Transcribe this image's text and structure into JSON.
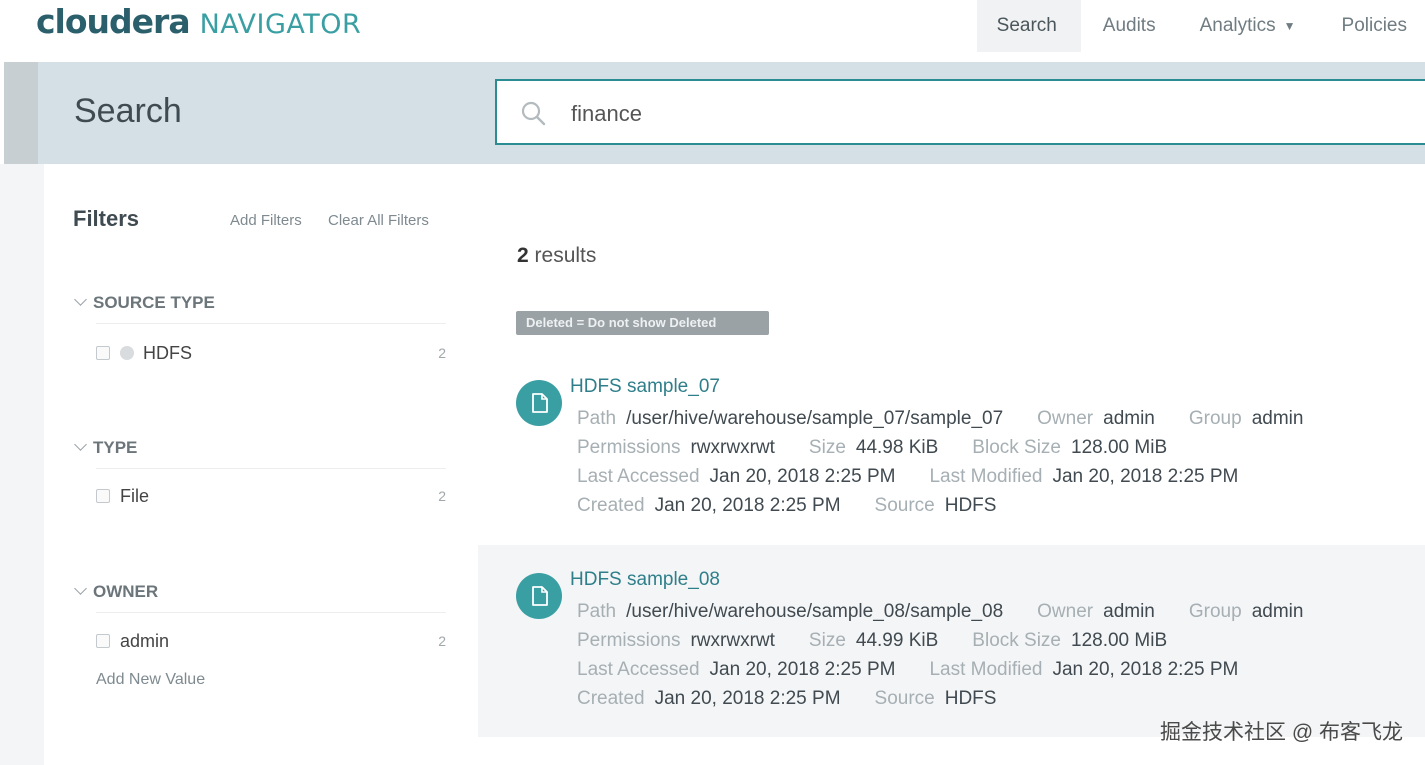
{
  "header": {
    "logo_brand": "cloudera",
    "logo_product": "NAVIGATOR",
    "nav": [
      {
        "label": "Search",
        "active": true
      },
      {
        "label": "Audits"
      },
      {
        "label": "Analytics",
        "has_dropdown": true
      },
      {
        "label": "Policies"
      }
    ]
  },
  "search": {
    "title": "Search",
    "query": "finance",
    "icon": "search-icon"
  },
  "filters": {
    "title": "Filters",
    "add_filters": "Add Filters",
    "clear_all": "Clear All Filters",
    "sections": [
      {
        "name": "SOURCE TYPE",
        "items": [
          {
            "label": "HDFS",
            "count": "2",
            "has_dot": true
          }
        ]
      },
      {
        "name": "TYPE",
        "items": [
          {
            "label": "File",
            "count": "2"
          }
        ]
      },
      {
        "name": "OWNER",
        "items": [
          {
            "label": "admin",
            "count": "2"
          }
        ]
      }
    ],
    "add_new_value": "Add New Value"
  },
  "results": {
    "count": "2",
    "count_suffix": " results",
    "filter_chip": "Deleted = Do not show Deleted",
    "items": [
      {
        "title": "HDFS sample_07",
        "path": "/user/hive/warehouse/sample_07/sample_07",
        "owner": "admin",
        "group": "admin",
        "permissions": "rwxrwxrwt",
        "size": "44.98 KiB",
        "block_size": "128.00 MiB",
        "last_accessed": "Jan 20, 2018 2:25 PM",
        "last_modified": "Jan 20, 2018 2:25 PM",
        "created": "Jan 20, 2018 2:25 PM",
        "source": "HDFS"
      },
      {
        "title": "HDFS sample_08",
        "path": "/user/hive/warehouse/sample_08/sample_08",
        "owner": "admin",
        "group": "admin",
        "permissions": "rwxrwxrwt",
        "size": "44.99 KiB",
        "block_size": "128.00 MiB",
        "last_accessed": "Jan 20, 2018 2:25 PM",
        "last_modified": "Jan 20, 2018 2:25 PM",
        "created": "Jan 20, 2018 2:25 PM",
        "source": "HDFS"
      }
    ]
  },
  "labels": {
    "path": "Path",
    "owner": "Owner",
    "group": "Group",
    "permissions": "Permissions",
    "size": "Size",
    "block_size": "Block Size",
    "last_accessed": "Last Accessed",
    "last_modified": "Last Modified",
    "created": "Created",
    "source": "Source"
  },
  "watermark": "掘金技术社区 @ 布客飞龙",
  "colors": {
    "brand_dark": "#2a5f6b",
    "brand_teal": "#3a9fa3",
    "search_band": "#d4dfe6",
    "chip_bg": "#9aa2a6"
  }
}
